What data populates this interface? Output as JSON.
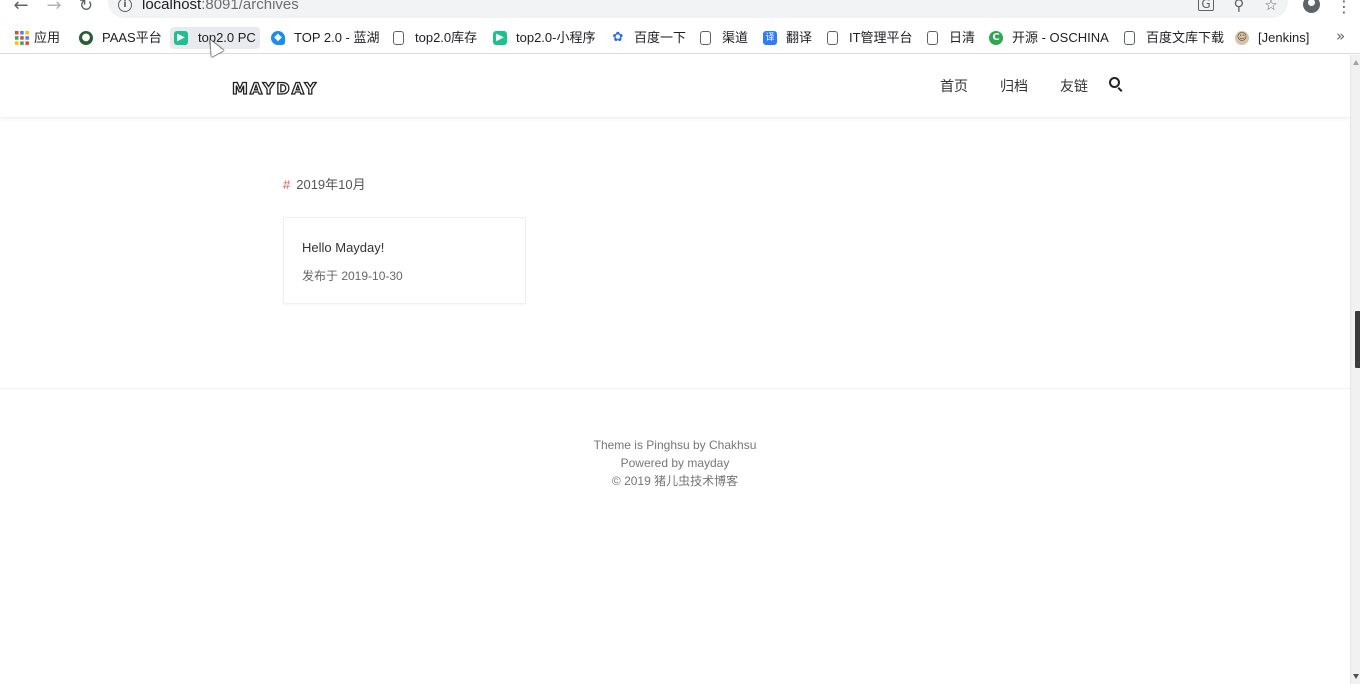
{
  "browser": {
    "url_host": "localhost",
    "url_rest": ":8091/archives",
    "icons": {
      "back": "arrow-left-icon",
      "forward": "arrow-right-icon",
      "reload": "reload-icon",
      "info": "info-icon",
      "translate": "translate-icon",
      "zoom": "zoom-icon",
      "bookmark": "star-icon",
      "profile": "profile-icon",
      "menu": "vertical-dots-icon"
    }
  },
  "bookmarks": [
    {
      "label": "应用",
      "icon": "apps-grid-icon"
    },
    {
      "label": "PAAS平台",
      "icon": "paas-logo-icon"
    },
    {
      "label": "top2.0 PC",
      "icon": "play-green-icon"
    },
    {
      "label": "TOP 2.0 - 蓝湖",
      "icon": "lanhu-icon"
    },
    {
      "label": "top2.0库存",
      "icon": "page-icon"
    },
    {
      "label": "top2.0-小程序",
      "icon": "play-green-icon"
    },
    {
      "label": "百度一下",
      "icon": "baidu-paw-icon"
    },
    {
      "label": "渠道",
      "icon": "page-icon"
    },
    {
      "label": "翻译",
      "icon": "translate-yi-icon"
    },
    {
      "label": "IT管理平台",
      "icon": "page-icon"
    },
    {
      "label": "日清",
      "icon": "page-icon"
    },
    {
      "label": "开源 - OSCHINA",
      "icon": "oschina-icon"
    },
    {
      "label": "百度文库下载",
      "icon": "page-icon"
    },
    {
      "label": "[Jenkins]",
      "icon": "jenkins-icon"
    }
  ],
  "site": {
    "logo": "MAYDAY",
    "nav": [
      {
        "label": "首页"
      },
      {
        "label": "归档"
      },
      {
        "label": "友链"
      }
    ],
    "search_icon": "search-icon"
  },
  "archive": {
    "hash": "#",
    "month": "2019年10月",
    "posts": [
      {
        "title": "Hello Mayday!",
        "date": "发布于 2019-10-30"
      }
    ]
  },
  "footer": {
    "line1": "Theme is Pinghsu by Chakhsu",
    "line2": "Powered by mayday",
    "line3": "© 2019 猪儿虫技术博客"
  },
  "colors": {
    "accent_hash": "#e8564a",
    "text": "#333333",
    "muted": "#777777"
  }
}
